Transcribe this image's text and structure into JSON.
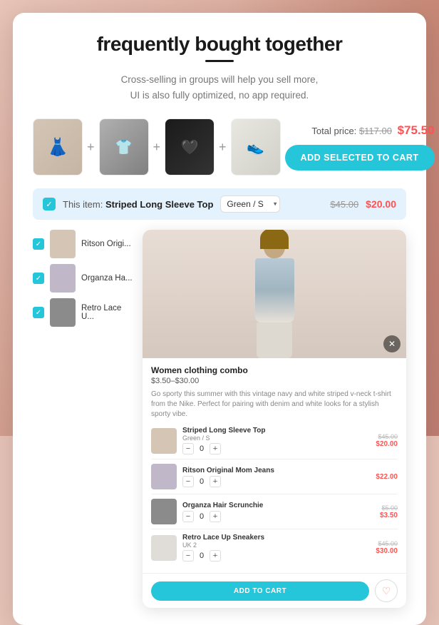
{
  "page": {
    "title": "frequently bought together",
    "subtitle_line1": "Cross-selling in groups will help you sell more,",
    "subtitle_line2": "UI is also fully optimized, no app required."
  },
  "products": [
    {
      "id": 1,
      "thumb_class": "thumb-1"
    },
    {
      "id": 2,
      "thumb_class": "thumb-2"
    },
    {
      "id": 3,
      "thumb_class": "thumb-3"
    },
    {
      "id": 4,
      "thumb_class": "thumb-4"
    }
  ],
  "pricing": {
    "label": "Total price:",
    "original": "$117.00",
    "sale": "$75.50"
  },
  "cta": {
    "add_selected": "ADD SELECTED TO CART"
  },
  "selected_item": {
    "label": "This item:",
    "name": "Striped Long Sleeve Top",
    "variant": "Green / S",
    "price_original": "$45.00",
    "price_sale": "$20.00"
  },
  "list_items": [
    {
      "name": "Ritson Origi...",
      "thumb_class": "list-thumb-1"
    },
    {
      "name": "Organza Ha...",
      "thumb_class": "list-thumb-2"
    },
    {
      "name": "Retro Lace U...",
      "thumb_class": "list-thumb-3"
    }
  ],
  "right_panel": {
    "combo_title": "Women clothing combo",
    "combo_price": "$3.50–$30.00",
    "combo_desc": "Go sporty this summer with this vintage navy and white striped v-neck t-shirt from the Nike. Perfect for pairing with denim and white looks for a stylish sporty vibe.",
    "add_to_cart": "ADD TO CART",
    "combo_items": [
      {
        "name": "Striped Long Sleeve Top",
        "variant": "Green / S",
        "price_orig": "$45.00",
        "price_sale": "$20.00",
        "qty": 0,
        "thumb_class": "combo-thumb-1"
      },
      {
        "name": "Ritson Original Mom Jeans",
        "variant": "",
        "price_orig": "",
        "price_sale": "$22.00",
        "qty": 0,
        "thumb_class": "combo-thumb-2"
      },
      {
        "name": "Organza Hair Scrunchie",
        "variant": "",
        "price_orig": "$5.00",
        "price_sale": "$3.50",
        "qty": 0,
        "thumb_class": "combo-thumb-3"
      },
      {
        "name": "Retro Lace Up Sneakers",
        "variant": "UK 2",
        "price_orig": "$45.00",
        "price_sale": "$30.00",
        "qty": 0,
        "thumb_class": "combo-thumb-4"
      }
    ]
  }
}
